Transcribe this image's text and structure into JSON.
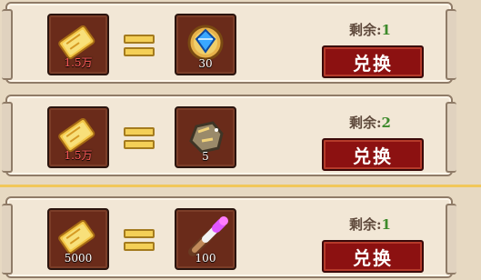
{
  "rows": [
    {
      "cost_amount": "1.5万",
      "reward_amount": "30",
      "remain_label": "剩余:",
      "remain_value": "1",
      "button_label": "兑换",
      "reward_icon": "blue-gem-medal-icon"
    },
    {
      "cost_amount": "1.5万",
      "reward_amount": "5",
      "remain_label": "剩余:",
      "remain_value": "2",
      "button_label": "兑换",
      "reward_icon": "gold-ore-icon"
    },
    {
      "cost_amount": "5000",
      "reward_amount": "100",
      "remain_label": "剩余:",
      "remain_value": "1",
      "button_label": "兑换",
      "reward_icon": "magic-torch-icon"
    }
  ],
  "colors": {
    "panel_bg": "#f2e7d6",
    "button_red": "#8c1111",
    "remain_green": "#3d8a2b",
    "cost_red": "#ff5b5b"
  }
}
